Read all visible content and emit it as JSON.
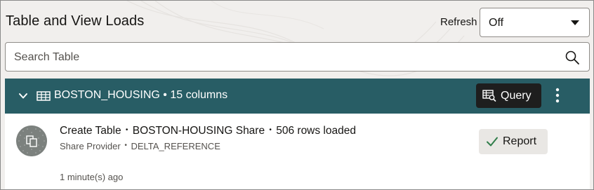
{
  "header": {
    "title": "Table and View Loads",
    "refresh_label": "Refresh",
    "refresh_value": "Off"
  },
  "search": {
    "placeholder": "Search Table"
  },
  "section": {
    "title": "BOSTON_HOUSING • 15 columns",
    "query_label": "Query"
  },
  "item": {
    "title": {
      "action": "Create Table",
      "share": "BOSTON-HOUSING Share",
      "rows": "506 rows loaded"
    },
    "subtitle": {
      "provider": "Share Provider",
      "reference": "DELTA_REFERENCE"
    },
    "time": "1 minute(s) ago",
    "report_label": "Report"
  },
  "icons": [
    "chevron-down-icon",
    "table-icon",
    "query-icon",
    "kebab-menu-icon",
    "search-icon",
    "caret-down-icon",
    "share-avatar-icon",
    "check-icon"
  ],
  "colors": {
    "section_bar": "#285d65",
    "query_button": "#1e1e1e",
    "report_button": "#e9e7e4",
    "check": "#2f7d4a",
    "background": "#f1efed"
  }
}
